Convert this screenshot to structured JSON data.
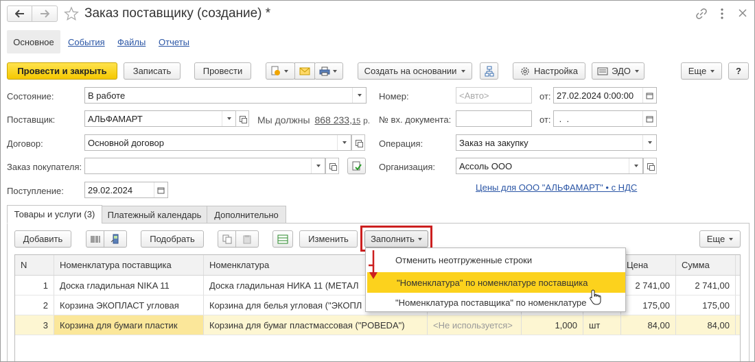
{
  "window": {
    "title": "Заказ поставщику (создание) *"
  },
  "section_tabs": [
    "Основное",
    "События",
    "Файлы",
    "Отчеты"
  ],
  "toolbar": {
    "post_and_close": "Провести и закрыть",
    "save": "Записать",
    "post": "Провести",
    "create_based_on": "Создать на основании",
    "settings": "Настройка",
    "edo": "ЭДО",
    "more": "Еще",
    "help": "?"
  },
  "form": {
    "state_label": "Состояние:",
    "state_value": "В работе",
    "supplier_label": "Поставщик:",
    "supplier_value": "АЛЬФАМАРТ",
    "debt_prefix": "Мы должны",
    "debt_amount": "868 233,",
    "debt_cents": "15",
    "debt_suffix": "р.",
    "contract_label": "Договор:",
    "contract_value": "Основной договор",
    "customer_order_label": "Заказ покупателя:",
    "customer_order_value": "",
    "receipt_label": "Поступление:",
    "receipt_value": "29.02.2024",
    "number_label": "Номер:",
    "number_placeholder": "<Авто>",
    "from_label": "от:",
    "date_value": "27.02.2024  0:00:00",
    "in_doc_label": "№ вх. документа:",
    "in_doc_value": "",
    "in_doc_from_label": "от:",
    "in_doc_date_value": " .  .",
    "operation_label": "Операция:",
    "operation_value": "Заказ на закупку",
    "org_label": "Организация:",
    "org_value": "Ассоль ООО",
    "prices_link": "Цены для ООО \"АЛЬФАМАРТ\" • с НДС"
  },
  "doc_tabs": [
    "Товары и услуги (3)",
    "Платежный календарь",
    "Дополнительно"
  ],
  "table_toolbar": {
    "add": "Добавить",
    "pick": "Подобрать",
    "change": "Изменить",
    "fill": "Заполнить",
    "more": "Еще"
  },
  "table": {
    "columns": [
      "N",
      "Номенклатура поставщика",
      "Номенклатура",
      "",
      "",
      "",
      "Цена",
      "Сумма"
    ],
    "rows": [
      {
        "n": "1",
        "supplier_item": "Доска гладильная  NIKA 11",
        "item": "Доска гладильная  НИКА 11 (МЕТАЛ",
        "char": "",
        "qty": "",
        "unit": "",
        "price": "2 741,00",
        "sum": "2 741,00"
      },
      {
        "n": "2",
        "supplier_item": "Корзина ЭКОПЛАСТ угловая",
        "item": "Корзина для белья угловая (\"ЭКОПЛ",
        "char": "",
        "qty": "",
        "unit": "",
        "price": "175,00",
        "sum": "175,00"
      },
      {
        "n": "3",
        "supplier_item": "Корзина для бумаги пластик",
        "item": "Корзина для бумаг пластмассовая (\"POBEDA\")",
        "char": "<Не используется>",
        "qty": "1,000",
        "unit": "шт",
        "price": "84,00",
        "sum": "84,00"
      }
    ]
  },
  "fill_menu": {
    "items": [
      "Отменить неотгруженные строки",
      "\"Номенклатура\" по номенклатуре поставщика",
      "\"Номенклатура поставщика\" по номенклатуре"
    ]
  },
  "colors": {
    "accent_yellow": "#f5c800",
    "highlight_row": "#fdf6d2",
    "menu_highlight": "#fcd21d",
    "annotation_red": "#cc1f1f",
    "link_blue": "#2a55a5"
  }
}
